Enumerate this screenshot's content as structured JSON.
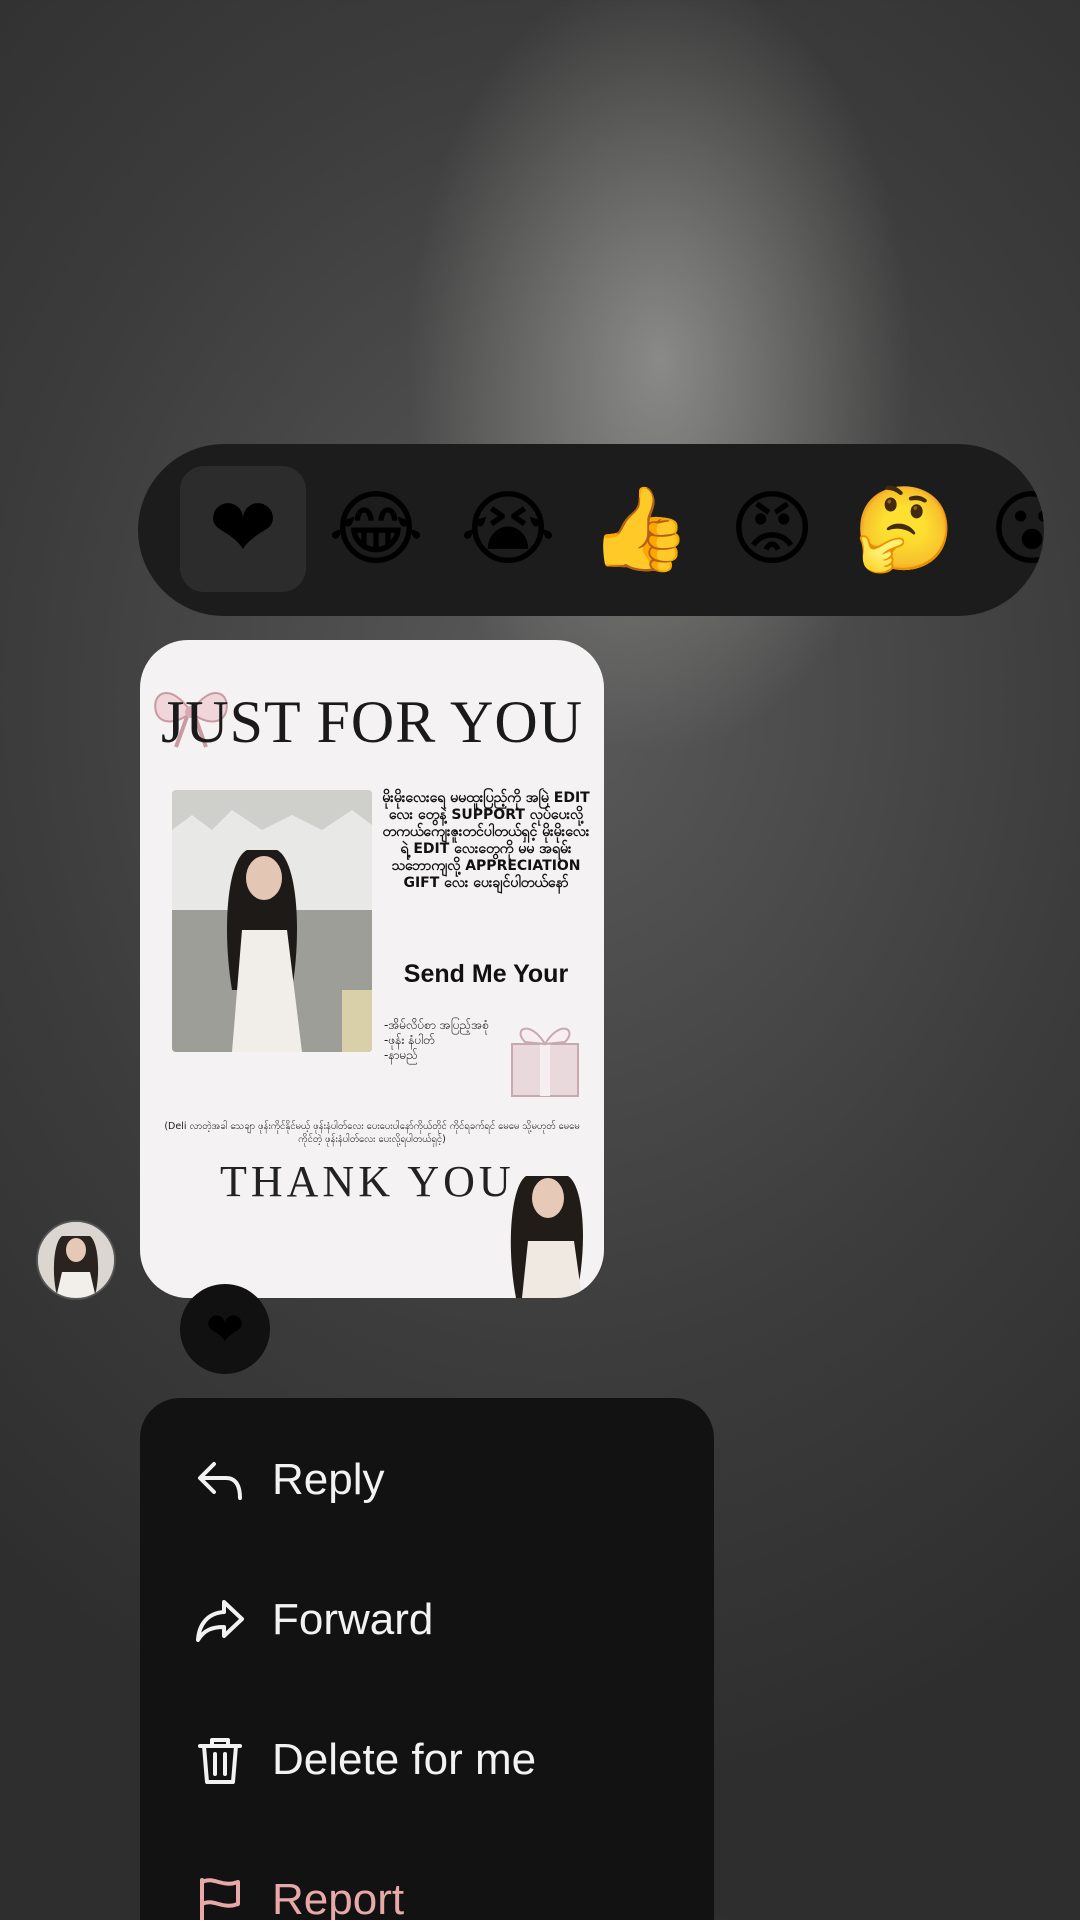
{
  "reactions": [
    {
      "emoji": "❤",
      "name": "heart",
      "selected": true
    },
    {
      "emoji": "😂",
      "name": "laughing-crying"
    },
    {
      "emoji": "😭",
      "name": "loudly-crying"
    },
    {
      "emoji": "👍",
      "name": "thumbs-up"
    },
    {
      "emoji": "😡",
      "name": "angry"
    },
    {
      "emoji": "🤔",
      "name": "thinking"
    },
    {
      "emoji": "😮",
      "name": "surprised-partial"
    }
  ],
  "card": {
    "title": "JUST FOR YOU",
    "body_text": "မိုးမိုးလေးရေ မမထူးပြည့်ကို အမြဲ EDIT လေး တွေနဲ့ SUPPORT လုပ်ပေးလို့ တကယ်ကျေးဇူးတင်ပါတယ်ရှင့် မိုးမိုးလေးရဲ့ EDIT လေးတွေကို မမ အရမ်းသဘောကျလို့ APPRECIATION GIFT လေး ပေးချင်ပါတယ်နော်",
    "send_me": "Send Me Your",
    "list_text": "-အိမ်လိပ်စာ အပြည့်အစုံ\n-ဖုန်း နံပါတ်\n-နာမည်",
    "footnote": "(Deli လာတဲ့အခါ သေချာ ဖုန်းကိုင်နိုင်မယ့် ဖုန်းနံပါတ်လေး ပေးပေးပါနော်ကိုယ်တိုင် ကိုင်ရခက်ရင် မေမေ သို့မဟုတ် မေမေ ကိုင်တဲ့ ဖုန်းနံပါတ်လေး ပေးလို့ရပါတယ်ရှင့်)",
    "thank_you": "THANK YOU"
  },
  "badge": {
    "emoji": "❤"
  },
  "menu": {
    "items": [
      {
        "label": "Reply",
        "icon": "reply-icon"
      },
      {
        "label": "Forward",
        "icon": "forward-icon"
      },
      {
        "label": "Delete for me",
        "icon": "trash-icon"
      },
      {
        "label": "Report",
        "icon": "flag-icon"
      }
    ]
  },
  "colors": {
    "menu_background": "#121212",
    "reaction_bar": "#1c1c1c",
    "report_text": "#e8a8a8"
  }
}
